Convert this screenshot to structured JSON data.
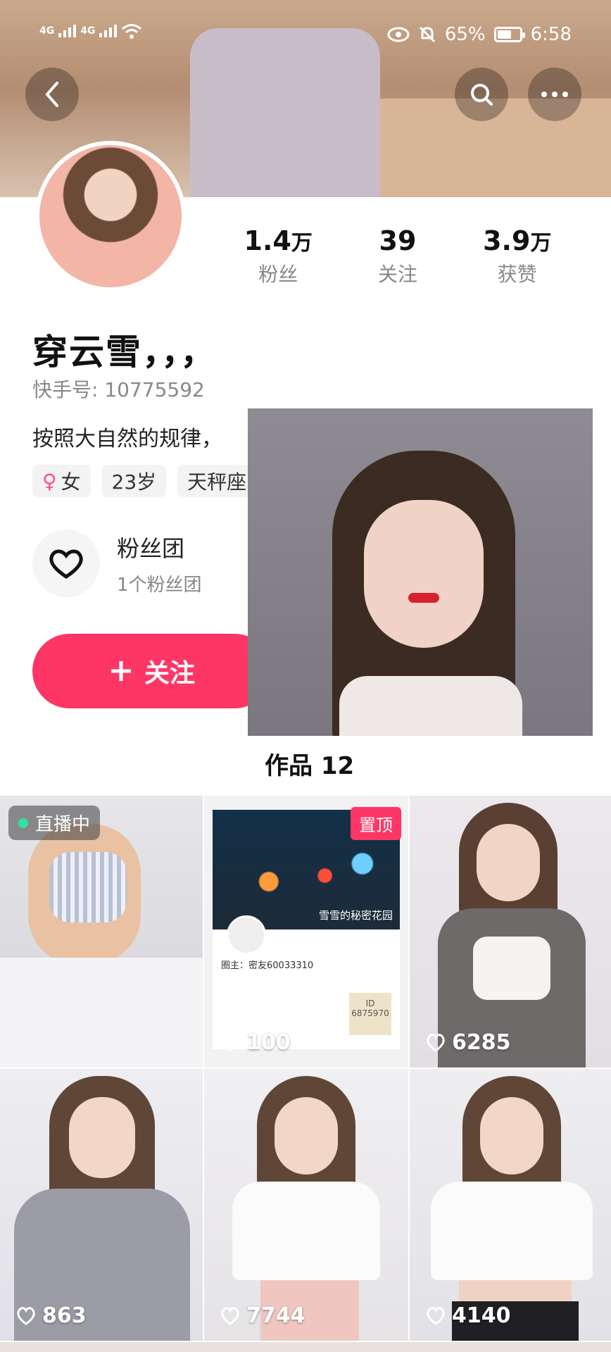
{
  "status_bar": {
    "network_1": "4G",
    "network_2": "4G",
    "battery": "65%",
    "battery_level": 0.65,
    "time": "6:58"
  },
  "header": {
    "back_icon": "chevron-left-icon",
    "search_icon": "search-icon",
    "more_icon": "more-dots-icon"
  },
  "profile": {
    "stats": [
      {
        "num": "1.4",
        "unit": "万",
        "label": "粉丝"
      },
      {
        "num": "39",
        "unit": "",
        "label": "关注"
      },
      {
        "num": "3.9",
        "unit": "万",
        "label": "获赞"
      }
    ],
    "name": "穿云雪，，，",
    "user_id": "快手号: 10775592",
    "bio": "按照大自然的规律，",
    "tags": [
      "女",
      "23岁",
      "天秤座"
    ],
    "fan_group": {
      "title": "粉丝团",
      "count": "1个粉丝团"
    },
    "follow_label": "关注"
  },
  "works": {
    "title": "作品 12",
    "items": [
      {
        "badge": "直播中",
        "likes": ""
      },
      {
        "badge": "置顶",
        "likes": "100",
        "caption": "雪雪的秘密花园",
        "owner": "圈主：密友60033310",
        "id_text": "ID 6875970"
      },
      {
        "badge": "",
        "likes": "6285"
      },
      {
        "badge": "",
        "likes": "863"
      },
      {
        "badge": "",
        "likes": "7744"
      },
      {
        "badge": "",
        "likes": "4140"
      }
    ]
  },
  "colors": {
    "accent": "#fe3666",
    "live_dot": "#32e3a0"
  }
}
